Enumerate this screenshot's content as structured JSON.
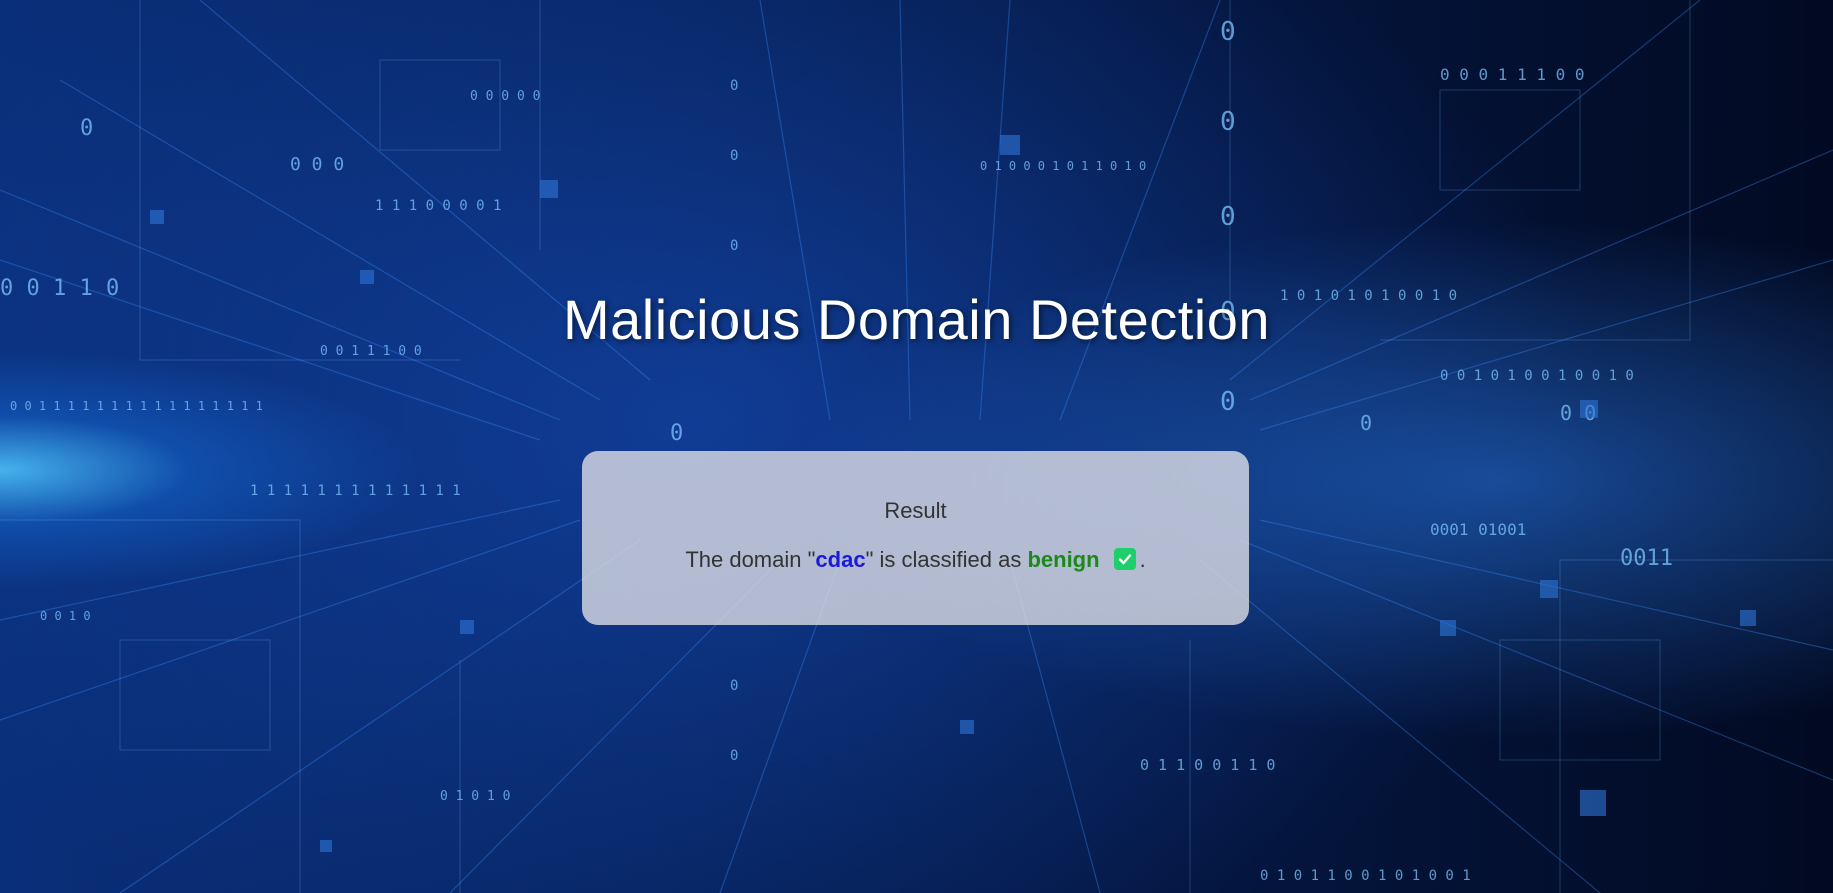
{
  "page": {
    "title": "Malicious Domain Detection"
  },
  "result": {
    "heading": "Result",
    "prefix": "The domain \"",
    "domain": "cdac",
    "middle": "\" is classified as ",
    "classification": "benign",
    "suffix": ".",
    "status_icon": "check-mark-icon"
  },
  "colors": {
    "domain": "#1a1adb",
    "classification": "#1b8a1b",
    "status_icon": "#1fcf6a",
    "card_background": "#e1e1e8"
  }
}
